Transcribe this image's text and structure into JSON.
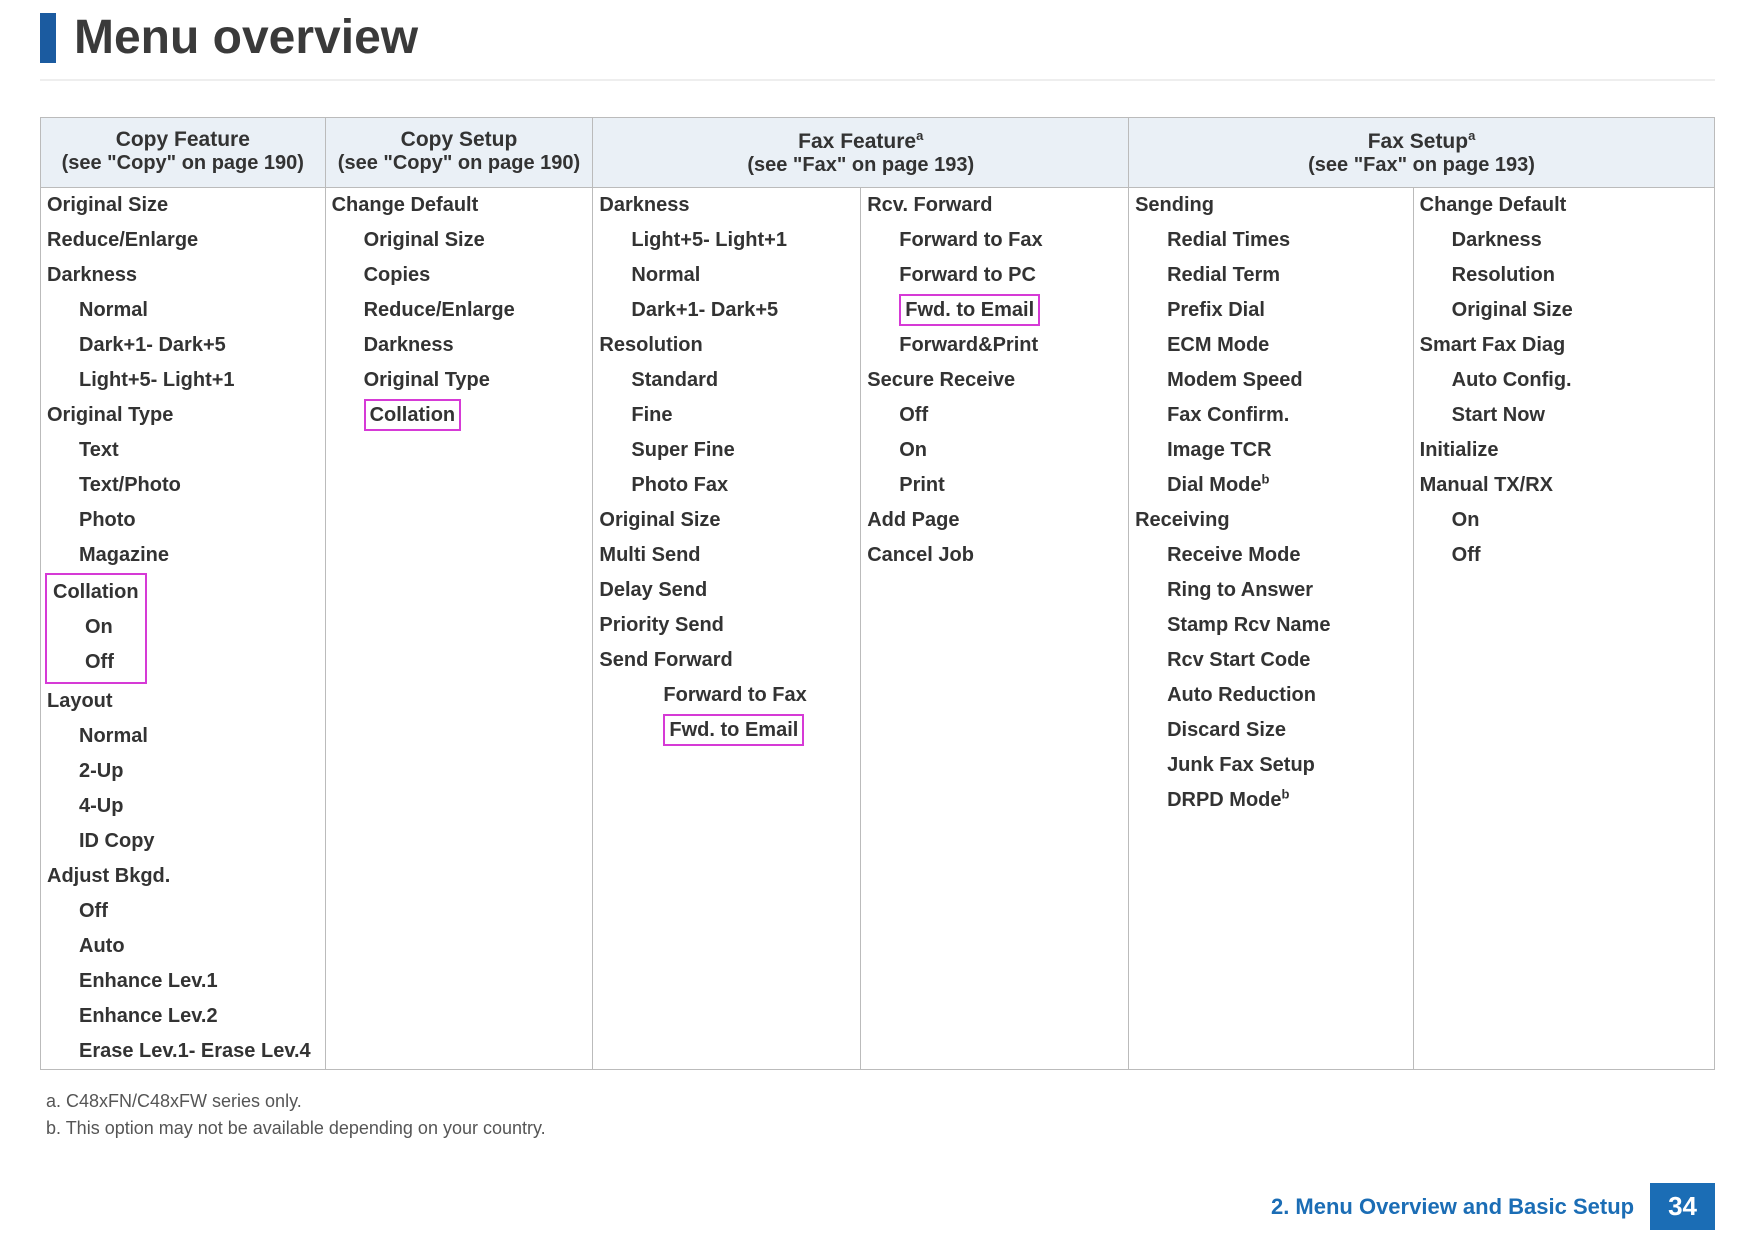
{
  "title": "Menu overview",
  "headers": {
    "copy_feature": {
      "title": "Copy Feature",
      "sub": "(see \"Copy\" on page 190)"
    },
    "copy_setup": {
      "title": "Copy Setup",
      "sub": "(see \"Copy\" on page 190)"
    },
    "fax_feature": {
      "title": "Fax Feature",
      "sup": "a",
      "sub": "(see \"Fax\" on page 193)"
    },
    "fax_setup": {
      "title": "Fax Setup",
      "sup": "a",
      "sub": "(see \"Fax\" on page 193)"
    }
  },
  "cols": {
    "copy_feature": [
      [
        "Original Size",
        1
      ],
      [
        "Reduce/Enlarge",
        1
      ],
      [
        "Darkness",
        1
      ],
      [
        "Normal",
        2
      ],
      [
        "Dark+1- Dark+5",
        2
      ],
      [
        "Light+5- Light+1",
        2
      ],
      [
        "Original Type",
        1
      ],
      [
        "Text",
        2
      ],
      [
        "Text/Photo",
        2
      ],
      [
        "Photo",
        2
      ],
      [
        "Magazine",
        2
      ],
      [
        "Collation",
        1,
        "hl-grp-start"
      ],
      [
        "On",
        2,
        "hl-grp-mid"
      ],
      [
        "Off",
        2,
        "hl-grp-end"
      ],
      [
        "Layout",
        1
      ],
      [
        "Normal",
        2
      ],
      [
        "2-Up",
        2
      ],
      [
        "4-Up",
        2
      ],
      [
        "ID Copy",
        2
      ],
      [
        "Adjust Bkgd.",
        1
      ],
      [
        "Off",
        2
      ],
      [
        "Auto",
        2
      ],
      [
        "Enhance Lev.1",
        2
      ],
      [
        "Enhance Lev.2",
        2
      ],
      [
        "Erase Lev.1- Erase Lev.4",
        2
      ]
    ],
    "copy_setup": [
      [
        "Change Default",
        1
      ],
      [
        "Original Size",
        2
      ],
      [
        "Copies",
        2
      ],
      [
        "Reduce/Enlarge",
        2
      ],
      [
        "Darkness",
        2
      ],
      [
        "Original Type",
        2
      ],
      [
        "Collation",
        2,
        "hl"
      ]
    ],
    "fax_feature_a": [
      [
        "Darkness",
        1
      ],
      [
        "Light+5- Light+1",
        2
      ],
      [
        "Normal",
        2
      ],
      [
        "Dark+1- Dark+5",
        2
      ],
      [
        "Resolution",
        1
      ],
      [
        "Standard",
        2
      ],
      [
        "Fine",
        2
      ],
      [
        "Super Fine",
        2
      ],
      [
        "Photo Fax",
        2
      ],
      [
        "Original Size",
        1
      ],
      [
        "Multi Send",
        1
      ],
      [
        "Delay Send",
        1
      ],
      [
        "Priority Send",
        1
      ],
      [
        "Send Forward",
        1
      ],
      [
        "Forward to Fax",
        3
      ],
      [
        "Fwd. to Email",
        3,
        "hl"
      ]
    ],
    "fax_feature_b": [
      [
        "Rcv. Forward",
        1
      ],
      [
        "Forward to Fax",
        2
      ],
      [
        "Forward to PC",
        2
      ],
      [
        "Fwd. to Email",
        2,
        "hl"
      ],
      [
        "Forward&Print",
        2
      ],
      [
        "Secure Receive",
        1
      ],
      [
        "Off",
        2
      ],
      [
        "On",
        2
      ],
      [
        "Print",
        2
      ],
      [
        "Add Page",
        1
      ],
      [
        "Cancel Job",
        1
      ]
    ],
    "fax_setup_a": [
      [
        "Sending",
        1
      ],
      [
        "Redial Times",
        2
      ],
      [
        "Redial Term",
        2
      ],
      [
        "Prefix Dial",
        2
      ],
      [
        "ECM Mode",
        2
      ],
      [
        "Modem Speed",
        2
      ],
      [
        "Fax Confirm.",
        2
      ],
      [
        "Image TCR",
        2
      ],
      [
        "Dial Mode",
        2,
        "",
        "b"
      ],
      [
        "Receiving",
        1
      ],
      [
        "Receive Mode",
        2
      ],
      [
        "Ring to Answer",
        2
      ],
      [
        "Stamp Rcv Name",
        2
      ],
      [
        "Rcv Start Code",
        2
      ],
      [
        "Auto Reduction",
        2
      ],
      [
        "Discard Size",
        2
      ],
      [
        "Junk Fax Setup",
        2
      ],
      [
        "DRPD Mode",
        2,
        "",
        "b"
      ]
    ],
    "fax_setup_b": [
      [
        "Change Default",
        1
      ],
      [
        "Darkness",
        2
      ],
      [
        "Resolution",
        2
      ],
      [
        "Original Size",
        2
      ],
      [
        "Smart Fax Diag",
        1
      ],
      [
        "Auto Config.",
        2
      ],
      [
        "Start Now",
        2
      ],
      [
        "Initialize",
        1
      ],
      [
        "Manual TX/RX",
        1
      ],
      [
        "On",
        2
      ],
      [
        "Off",
        2
      ]
    ]
  },
  "footnotes": {
    "a": "a.   C48xFN/C48xFW series only.",
    "b": "b.  This option may not be available depending on your country."
  },
  "footer": {
    "chapter": "2. Menu Overview and Basic Setup",
    "page": "34"
  }
}
